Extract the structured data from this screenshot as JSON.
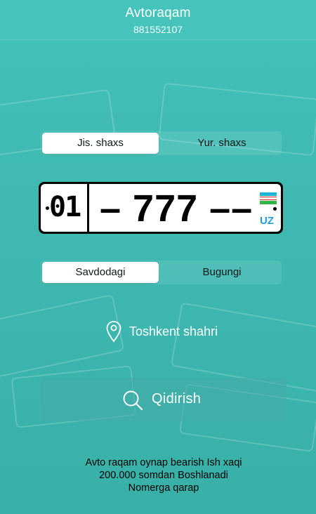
{
  "header": {
    "title": "Avtoraqam",
    "phone": "881552107"
  },
  "owner_type": {
    "options": [
      "Jis. shaxs",
      "Yur. shaxs"
    ],
    "selected": "Jis. shaxs"
  },
  "plate": {
    "region": "01",
    "number": "– 777 ––",
    "country_code": "UZ",
    "flag_colors": [
      "#1eb4d4",
      "#ffffff",
      "#2fb34a"
    ]
  },
  "listing_type": {
    "options": [
      "Savdodagi",
      "Bugungi"
    ],
    "selected": "Savdodagi"
  },
  "location": {
    "icon": "location-pin-icon",
    "label": "Toshkent shahri"
  },
  "search": {
    "icon": "search-icon",
    "label": "Qidirish"
  },
  "footer": {
    "lines": [
      "Avto raqam oynap bearish Ish xaqi",
      "200.000 somdan Boshlanadi",
      "Nomerga qarap"
    ]
  },
  "colors": {
    "background": "#3dbab4",
    "accent": "#46c4bc"
  }
}
